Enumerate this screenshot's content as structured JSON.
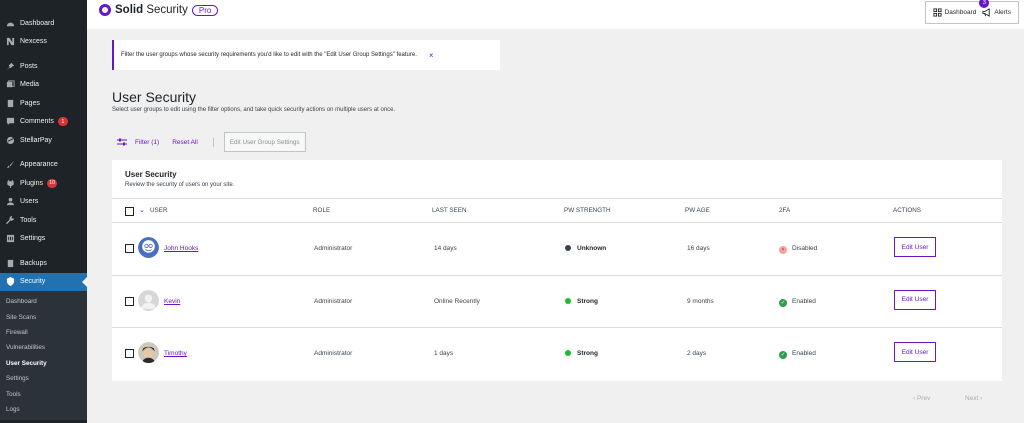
{
  "sidebar": {
    "items": [
      {
        "label": "Dashboard",
        "icon": "dashboard-icon"
      },
      {
        "label": "Nexcess",
        "icon": "nexcess-icon"
      },
      {
        "label": "Posts",
        "icon": "pin-icon"
      },
      {
        "label": "Media",
        "icon": "media-icon"
      },
      {
        "label": "Pages",
        "icon": "pages-icon"
      },
      {
        "label": "Comments",
        "icon": "comment-icon",
        "badge": "1"
      },
      {
        "label": "StellarPay",
        "icon": "stellarpay-icon"
      },
      {
        "label": "Appearance",
        "icon": "brush-icon"
      },
      {
        "label": "Plugins",
        "icon": "plugin-icon",
        "badge": "10"
      },
      {
        "label": "Users",
        "icon": "user-icon"
      },
      {
        "label": "Tools",
        "icon": "wrench-icon"
      },
      {
        "label": "Settings",
        "icon": "settings-icon"
      },
      {
        "label": "Backups",
        "icon": "backup-icon"
      },
      {
        "label": "Security",
        "icon": "shield-icon"
      }
    ],
    "submenu": [
      "Dashboard",
      "Site Scans",
      "Firewall",
      "Vulnerabilities",
      "User Security",
      "Settings",
      "Tools",
      "Logs"
    ]
  },
  "header": {
    "brand_bold": "Solid",
    "brand_rest": " Security",
    "pro": "Pro",
    "dashboard_label": "Dashboard",
    "alerts_label": "Alerts",
    "alerts_count": "3"
  },
  "notice": {
    "text": "Filter the user groups whose security requirements you'd like to edit with the \"Edit User Group Settings\" feature.",
    "close": "×"
  },
  "page": {
    "title": "User Security",
    "description": "Select user groups to edit using the filter options, and take quick security actions on multiple users at once."
  },
  "toolbar": {
    "filter_label": "Filter (1)",
    "reset_label": "Reset All",
    "edit_group_label": "Edit User Group Settings"
  },
  "card": {
    "title": "User Security",
    "subtitle": "Review the security of users on your site."
  },
  "columns": {
    "user": "USER",
    "role": "ROLE",
    "last_seen": "LAST SEEN",
    "pw_strength": "PW STRENGTH",
    "pw_age": "PW AGE",
    "twofa": "2FA",
    "actions": "ACTIONS"
  },
  "rows": [
    {
      "name": "John Hooks",
      "role": "Administrator",
      "last_seen": "14 days",
      "strength": "Unknown",
      "strength_color": "#3c434a",
      "pw_age": "16 days",
      "twofa": "Disabled",
      "twofa_color": "#f5a3a3",
      "twofa_glyph": "×",
      "action": "Edit User"
    },
    {
      "name": "Kevin",
      "role": "Administrator",
      "last_seen": "Online Recently",
      "strength": "Strong",
      "strength_color": "#1ebc2e",
      "pw_age": "9 months",
      "twofa": "Enabled",
      "twofa_color": "#2e9b4e",
      "twofa_glyph": "✓",
      "action": "Edit User"
    },
    {
      "name": "Timothy",
      "role": "Administrator",
      "last_seen": "1 days",
      "strength": "Strong",
      "strength_color": "#1ebc2e",
      "pw_age": "2 days",
      "twofa": "Enabled",
      "twofa_color": "#2e9b4e",
      "twofa_glyph": "✓",
      "action": "Edit User"
    }
  ],
  "pagination": {
    "prev": "‹  Prev",
    "next": "Next  ›"
  },
  "colors": {
    "accent": "#6817c5",
    "sidebar_bg": "#1d2327",
    "active_menu": "#2271b1"
  }
}
